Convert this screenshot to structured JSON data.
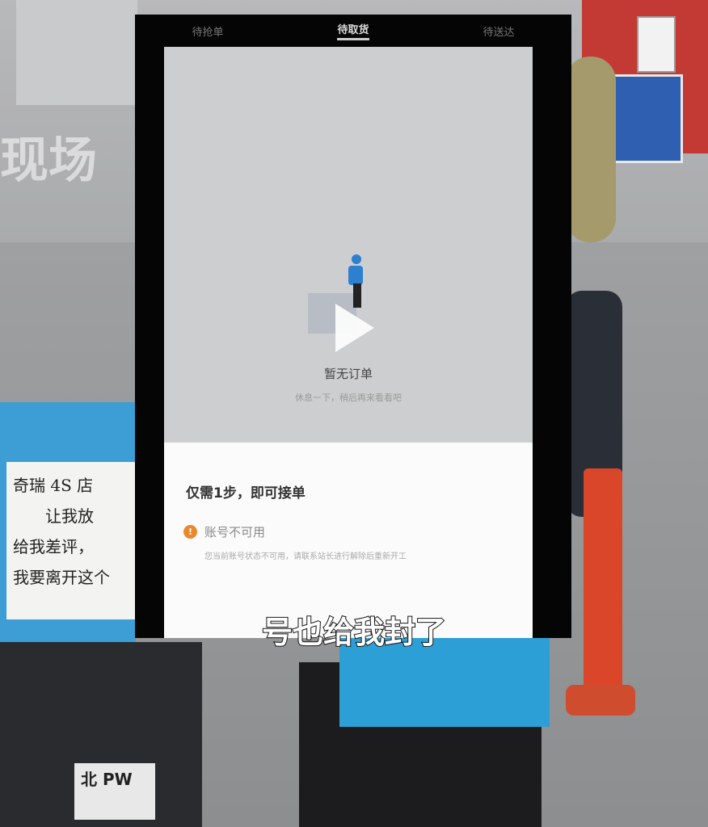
{
  "phone": {
    "tabs": [
      {
        "label": "待抢单",
        "active": false
      },
      {
        "label": "待取货",
        "active": true
      },
      {
        "label": "待送达",
        "active": false
      }
    ],
    "empty_state": {
      "title": "暂无订单",
      "subtitle": "休息一下，稍后再来看看吧"
    },
    "sheet": {
      "title": "仅需1步，即可接单",
      "warning_title": "账号不可用",
      "warning_desc": "您当前账号状态不可用，请联系站长进行解除后重新开工",
      "warning_color": "#e8892f"
    }
  },
  "video": {
    "caption": "号也给我封了",
    "watermark": "现场"
  },
  "scene": {
    "sign_lines": [
      "奇瑞 4S 店",
      "让我放",
      "给我差评，",
      "我要离开这个"
    ],
    "plate": "北 PW"
  }
}
